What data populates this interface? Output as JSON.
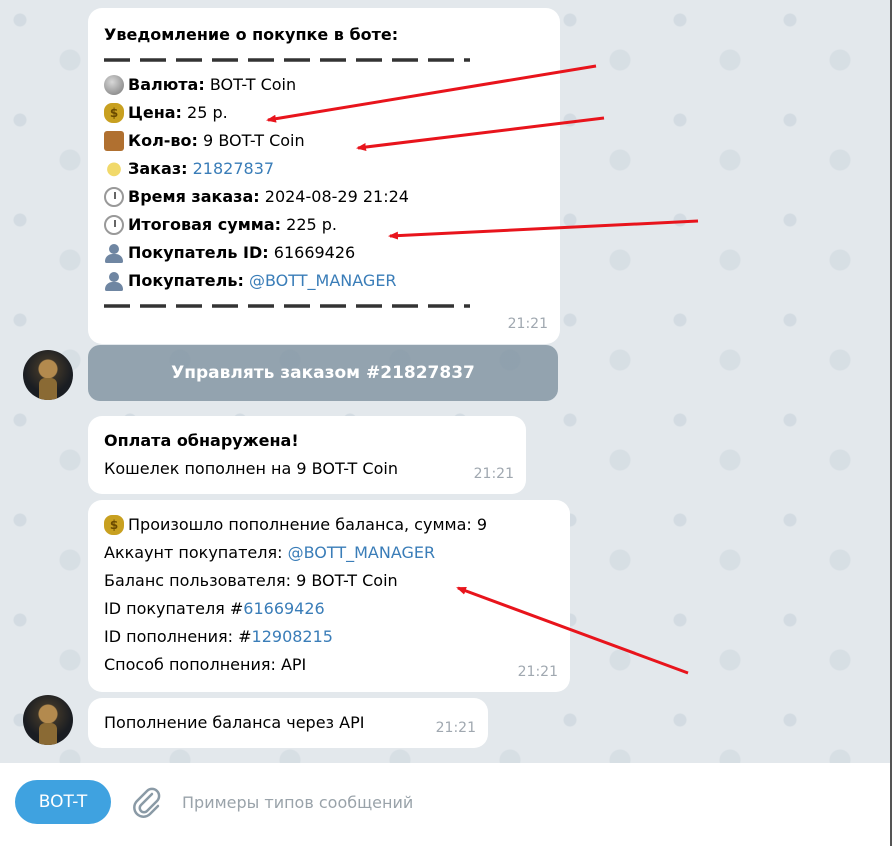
{
  "message1": {
    "title": "Уведомление о покупке в боте:",
    "rows": [
      {
        "icon": "coin-icon",
        "label": "Валюта:",
        "value": "BOT-T Coin"
      },
      {
        "icon": "money-bag-icon",
        "label": "Цена:",
        "value": "25 р."
      },
      {
        "icon": "package-icon",
        "label": "Кол-во:",
        "value": "9 BOT-T Coin"
      },
      {
        "icon": "lightbulb-icon",
        "label": "Заказ:",
        "value": "21827837"
      },
      {
        "icon": "clock-icon",
        "label": "Время заказа:",
        "value": "2024-08-29 21:24"
      },
      {
        "icon": "clock-icon",
        "label": "Итоговая сумма:",
        "value": "225 р."
      },
      {
        "icon": "user-icon",
        "label": "Покупатель ID:",
        "value": "61669426"
      },
      {
        "icon": "user-icon",
        "label": "Покупатель:",
        "value": "@BOTT_MANAGER"
      }
    ],
    "time": "21:21"
  },
  "action_button": "Управлять заказом #21827837",
  "message2": {
    "title": "Оплата обнаружена!",
    "text": "Кошелек пополнен на 9 BOT-T Coin",
    "time": "21:21"
  },
  "message3": {
    "line1": "Произошло пополнение баланса, сумма: 9",
    "line2_label": "Аккаунт покупателя:",
    "line2_value": "@BOTT_MANAGER",
    "line3": "Баланс пользователя: 9 BOT-T Coin",
    "line4_label": "ID покупателя #",
    "line4_value": "61669426",
    "line5_label": "ID пополнения: #",
    "line5_value": "12908215",
    "line6": "Способ пополнения: API",
    "time": "21:21"
  },
  "message4": {
    "text": "Пополнение баланса через API",
    "time": "21:21"
  },
  "composer": {
    "bot_button": "BOT-T",
    "placeholder": "Примеры типов сообщений"
  },
  "colors": {
    "background": "#e3e8ec",
    "link": "#3a7db8",
    "accent": "#3fa2e0",
    "arrow": "#e8141c"
  }
}
